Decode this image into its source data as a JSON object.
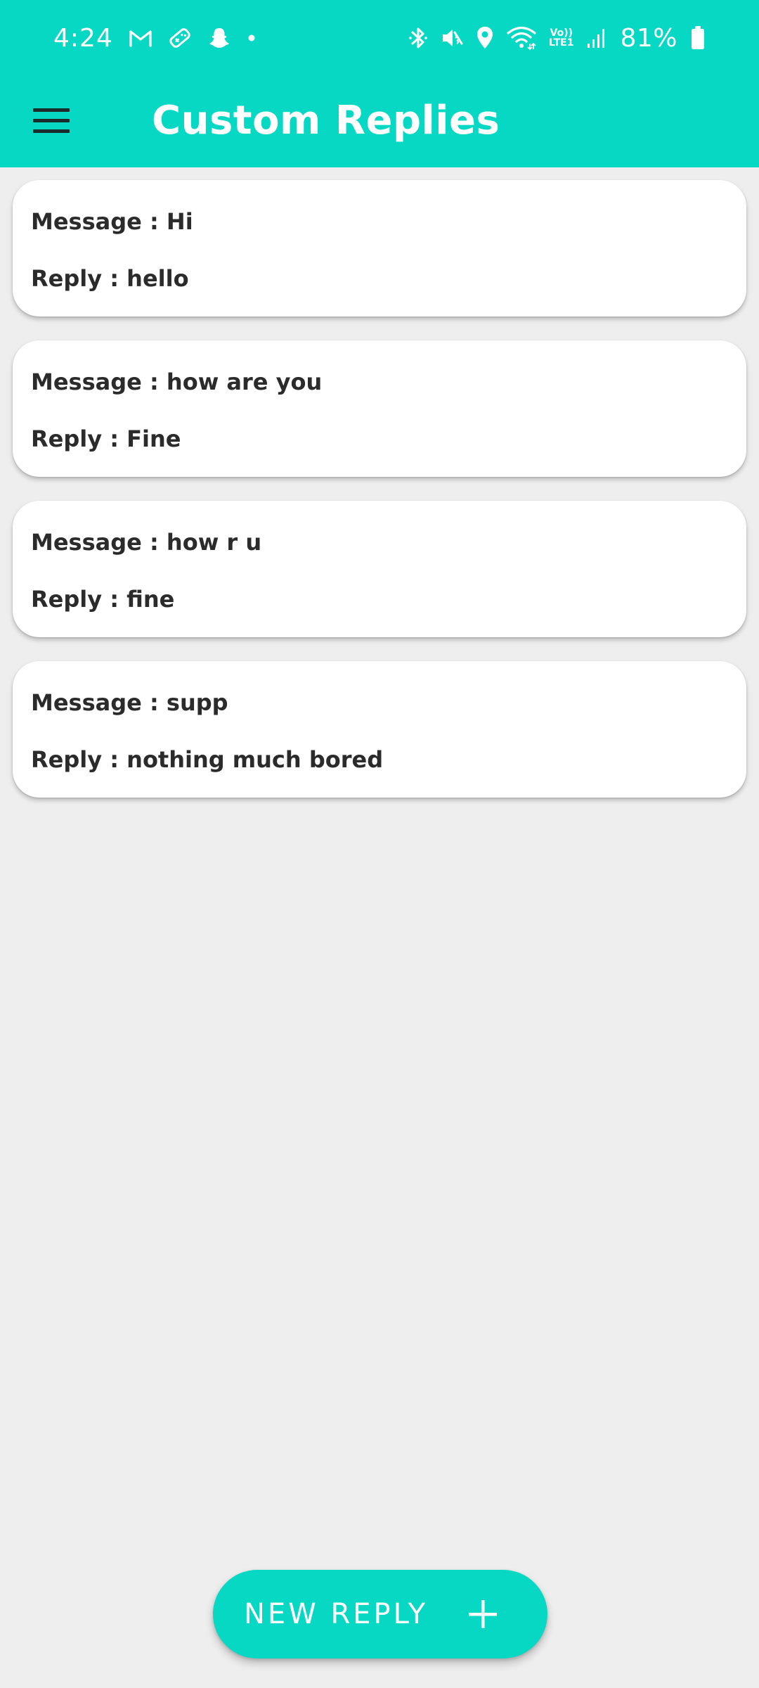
{
  "status_bar": {
    "time": "4:24",
    "battery": "81%",
    "network": "LTE1",
    "volte": "Vo))",
    "left_icons": [
      "gmail-icon",
      "game-controller-icon",
      "snapchat-icon",
      "dot-icon"
    ],
    "right_icons": [
      "bluetooth-icon",
      "vibrate-icon",
      "location-icon",
      "wifi-icon",
      "volte-icon",
      "signal-icon",
      "battery-icon"
    ]
  },
  "app_bar": {
    "title": "Custom Replies",
    "menu_icon": "hamburger-menu-icon"
  },
  "replies": [
    {
      "message": "Message : Hi",
      "reply": "Reply : hello"
    },
    {
      "message": "Message : how are you",
      "reply": "Reply : Fine"
    },
    {
      "message": "Message : how r u",
      "reply": "Reply : fine"
    },
    {
      "message": "Message : supp",
      "reply": "Reply : nothing much bored"
    }
  ],
  "fab": {
    "label": "NEW REPLY",
    "icon": "plus-icon"
  },
  "colors": {
    "accent": "#06d8c4",
    "background": "#eeeeee",
    "card": "#ffffff",
    "text": "#2b2b2b"
  }
}
